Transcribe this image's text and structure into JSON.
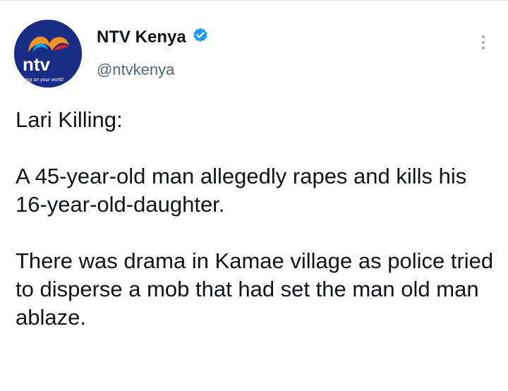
{
  "account": {
    "display_name": "NTV Kenya",
    "handle": "@ntvkenya",
    "avatar_logo_text": "ntv",
    "avatar_tagline": "turning on your world",
    "verified_icon": "verified-badge-icon"
  },
  "tweet": {
    "paragraphs": [
      "Lari Killing:",
      "A 45-year-old man allegedly rapes and kills his 16-year-old-daughter.",
      "There was drama in Kamae village as police tried to disperse a mob that had set the man old man ablaze."
    ]
  },
  "menu": {
    "icon": "more-options-icon"
  },
  "colors": {
    "text_primary": "#0f1419",
    "text_secondary": "#536471",
    "verified": "#1d9bf0",
    "avatar_bg": "#1a2d86"
  }
}
